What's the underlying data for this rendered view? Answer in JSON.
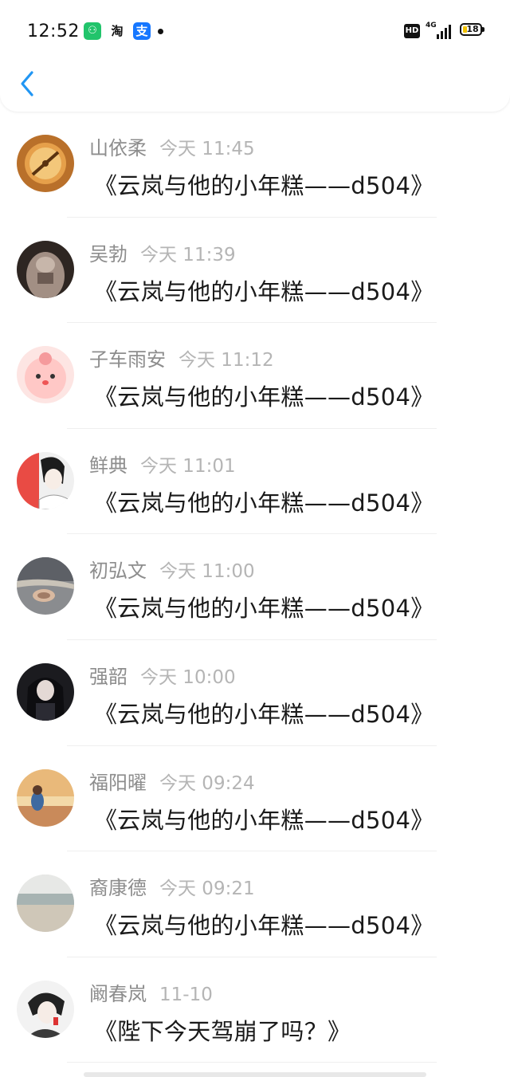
{
  "status_bar": {
    "time": "12:52",
    "apps": [
      {
        "icon": "phone-manager-icon",
        "glyph": "⚇"
      },
      {
        "icon": "taobao-icon",
        "glyph": "淘"
      },
      {
        "icon": "alipay-icon",
        "glyph": "支"
      }
    ],
    "hd_label": "HD",
    "signal_label": "4G",
    "battery_level": "18"
  },
  "colors": {
    "accent": "#2196f3",
    "name": "#8d8d8d",
    "timestamp": "#b5b5b5",
    "message": "#1a1a1a"
  },
  "messages": [
    {
      "name": "山依柔",
      "time": "今天 11:45",
      "text": "《云岚与他的小年糕——d504》"
    },
    {
      "name": "吴勃",
      "time": "今天 11:39",
      "text": "《云岚与他的小年糕——d504》"
    },
    {
      "name": "子车雨安",
      "time": "今天 11:12",
      "text": "《云岚与他的小年糕——d504》"
    },
    {
      "name": "鲜典",
      "time": "今天 11:01",
      "text": "《云岚与他的小年糕——d504》"
    },
    {
      "name": "初弘文",
      "time": "今天 11:00",
      "text": "《云岚与他的小年糕——d504》"
    },
    {
      "name": "强韶",
      "time": "今天 10:00",
      "text": "《云岚与他的小年糕——d504》"
    },
    {
      "name": "福阳曜",
      "time": "今天 09:24",
      "text": "《云岚与他的小年糕——d504》"
    },
    {
      "name": "裔康德",
      "time": "今天 09:21",
      "text": "《云岚与他的小年糕——d504》"
    },
    {
      "name": "阚春岚",
      "time": "11-10",
      "text": "《陛下今天驾崩了吗？》"
    }
  ]
}
